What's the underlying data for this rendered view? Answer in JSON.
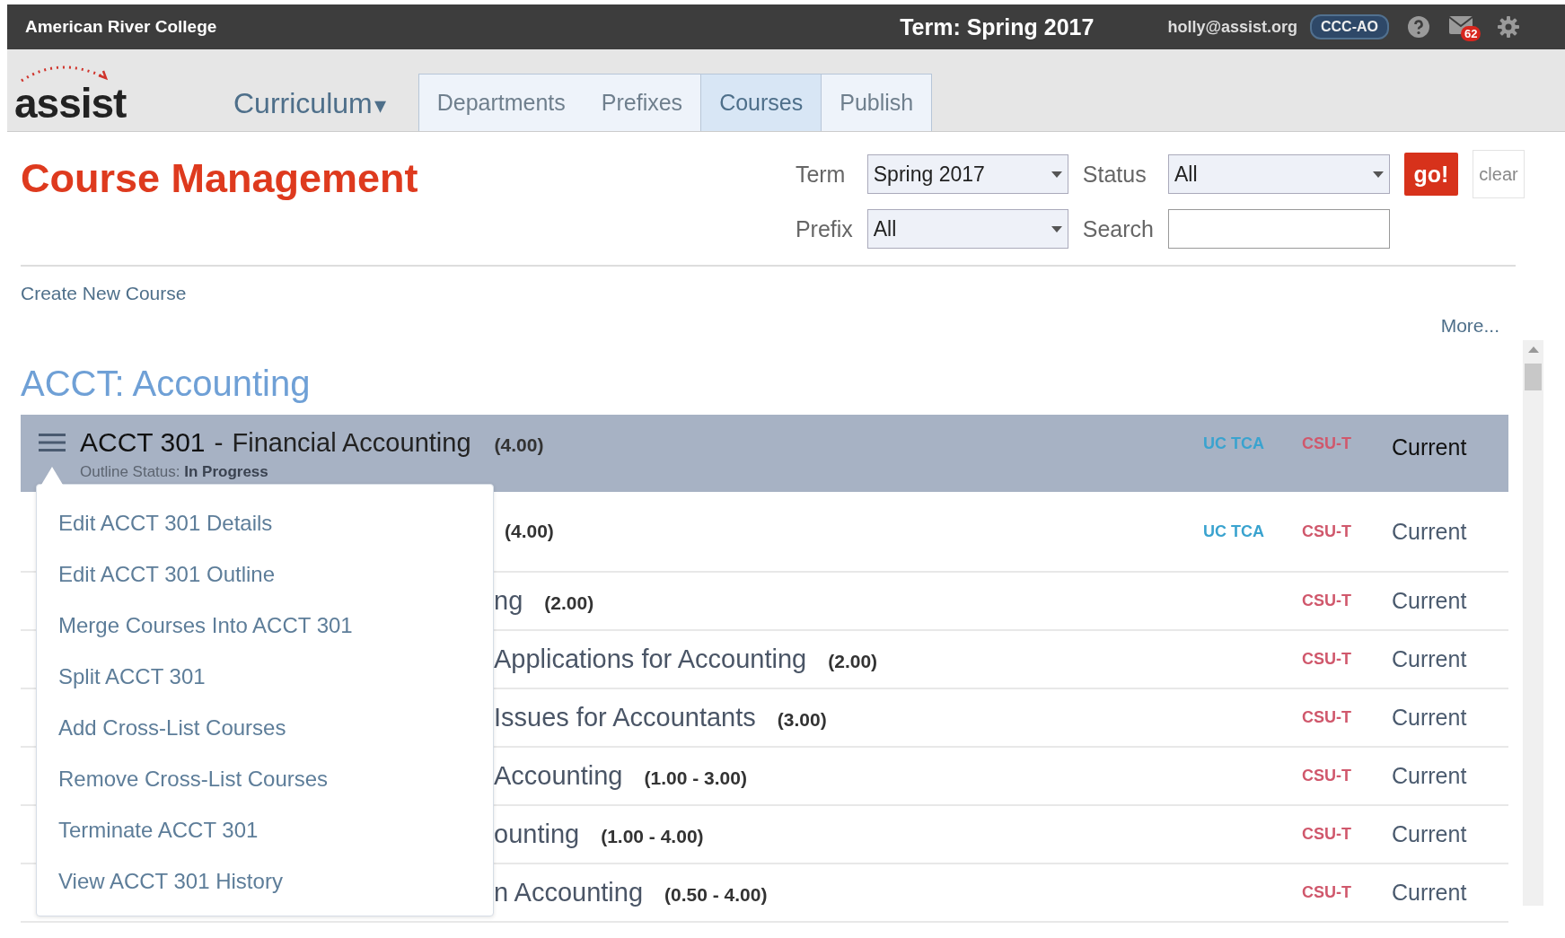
{
  "top_bar": {
    "college": "American River College",
    "term": "Term: Spring 2017",
    "user": "holly@assist.org",
    "role_badge": "CCC-AO",
    "mail_count": "62"
  },
  "nav": {
    "logo": "assist",
    "menu": "Curriculum",
    "menu_caret": "▾",
    "tabs": [
      {
        "label": "Departments",
        "selected": false
      },
      {
        "label": "Prefixes",
        "selected": false
      },
      {
        "label": "Courses",
        "selected": true
      },
      {
        "label": "Publish",
        "selected": false
      }
    ]
  },
  "page_title": "Course Management",
  "filters": {
    "term_label": "Term",
    "term_value": "Spring 2017",
    "status_label": "Status",
    "status_value": "All",
    "prefix_label": "Prefix",
    "prefix_value": "All",
    "search_label": "Search",
    "go_button": "go!",
    "clear_button": "clear"
  },
  "create_link": "Create New Course",
  "more_link": "More...",
  "department": "ACCT: Accounting",
  "courses": [
    {
      "selected": true,
      "code": "ACCT 301",
      "separator": "-",
      "title": "Financial Accounting",
      "units": "(4.00)",
      "outline_status": "Outline Status: **In Progress**",
      "uc_tca": "UC TCA",
      "csu": "CSU-T",
      "status": "Current"
    },
    {
      "selected": false,
      "units": "(4.00)",
      "uc_tca": "UC TCA",
      "csu": "CSU-T",
      "status": "Current"
    },
    {
      "selected": false,
      "title": "ng",
      "units": "(2.00)",
      "csu": "CSU-T",
      "status": "Current"
    },
    {
      "selected": false,
      "title": "Applications for Accounting",
      "units": "(2.00)",
      "csu": "CSU-T",
      "status": "Current"
    },
    {
      "selected": false,
      "title": "Issues for Accountants",
      "units": "(3.00)",
      "csu": "CSU-T",
      "status": "Current"
    },
    {
      "selected": false,
      "title": "Accounting",
      "units": "(1.00 - 3.00)",
      "csu": "CSU-T",
      "status": "Current"
    },
    {
      "selected": false,
      "title": "ounting",
      "units": "(1.00 - 4.00)",
      "csu": "CSU-T",
      "status": "Current"
    },
    {
      "selected": false,
      "title": "n Accounting",
      "units": "(0.50 - 4.00)",
      "csu": "CSU-T",
      "status": "Current"
    }
  ],
  "context_menu": [
    "Edit ACCT 301 Details",
    "Edit ACCT 301 Outline",
    "Merge Courses Into ACCT 301",
    "Split ACCT 301",
    "Add Cross-List Courses",
    "Remove Cross-List Courses",
    "Terminate ACCT 301",
    "View ACCT 301 History"
  ]
}
